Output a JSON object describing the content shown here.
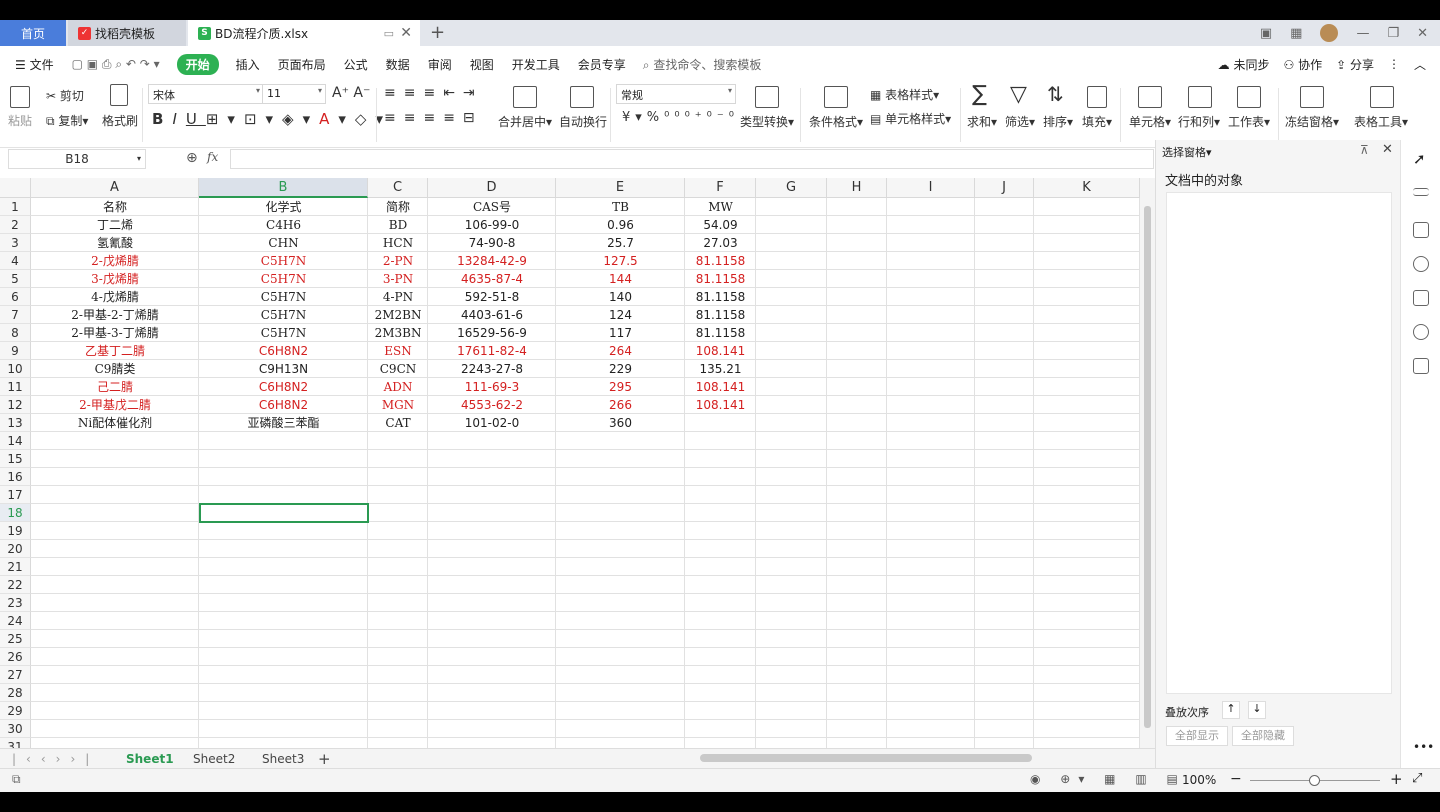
{
  "tabs": {
    "home": "首页",
    "docer": "找稻壳模板",
    "file": "BD流程介质.xlsx"
  },
  "menu": {
    "file": "文件",
    "items": [
      "开始",
      "插入",
      "页面布局",
      "公式",
      "数据",
      "审阅",
      "视图",
      "开发工具",
      "会员专享"
    ],
    "search": "查找命令、搜索模板",
    "sync": "未同步",
    "collab": "协作",
    "share": "分享"
  },
  "ribbon": {
    "paste": "粘贴",
    "cut": "剪切",
    "copy": "复制",
    "format_painter": "格式刷",
    "font": "宋体",
    "size": "11",
    "merge": "合并居中",
    "wrap": "自动换行",
    "number_format": "常规",
    "type_convert": "类型转换",
    "cond_format": "条件格式",
    "table_style": "表格样式",
    "cell_style": "单元格样式",
    "sum": "求和",
    "filter": "筛选",
    "sort": "排序",
    "fill": "填充",
    "cell": "单元格",
    "rowcol": "行和列",
    "sheet": "工作表",
    "freeze": "冻结窗格",
    "tools": "表格工具"
  },
  "formula_bar": {
    "cell_ref": "B18",
    "fx": "fx",
    "content": ""
  },
  "columns": [
    "A",
    "B",
    "C",
    "D",
    "E",
    "F",
    "G",
    "H",
    "I",
    "J",
    "K"
  ],
  "selected_col": "B",
  "selected_row": 18,
  "rows": [
    {
      "n": 1,
      "red": false,
      "cells": [
        "名称",
        "化学式",
        "简称",
        "CAS号",
        "TB",
        "MW"
      ]
    },
    {
      "n": 2,
      "red": false,
      "cells": [
        "丁二烯",
        "C4H6",
        "BD",
        "106-99-0",
        "0.96",
        "54.09"
      ]
    },
    {
      "n": 3,
      "red": false,
      "cells": [
        "氢氰酸",
        "CHN",
        "HCN",
        "74-90-8",
        "25.7",
        "27.03"
      ]
    },
    {
      "n": 4,
      "red": true,
      "cells": [
        "2-戊烯腈",
        "C5H7N",
        "2-PN",
        "13284-42-9",
        "127.5",
        "81.1158"
      ]
    },
    {
      "n": 5,
      "red": true,
      "cells": [
        "3-戊烯腈",
        "C5H7N",
        "3-PN",
        "4635-87-4",
        "144",
        "81.1158"
      ]
    },
    {
      "n": 6,
      "red": false,
      "cells": [
        "4-戊烯腈",
        "C5H7N",
        "4-PN",
        "592-51-8",
        "140",
        "81.1158"
      ]
    },
    {
      "n": 7,
      "red": false,
      "cells": [
        "2-甲基-2-丁烯腈",
        "C5H7N",
        "2M2BN",
        "4403-61-6",
        "124",
        "81.1158"
      ]
    },
    {
      "n": 8,
      "red": false,
      "cells": [
        "2-甲基-3-丁烯腈",
        "C5H7N",
        "2M3BN",
        "16529-56-9",
        "117",
        "81.1158"
      ]
    },
    {
      "n": 9,
      "red": true,
      "cells": [
        "乙基丁二腈",
        "C6H8N2",
        "ESN",
        "17611-82-4",
        "264",
        "108.141"
      ]
    },
    {
      "n": 10,
      "red": false,
      "cells": [
        "C9腈类",
        "C9H13N",
        "C9CN",
        "2243-27-8",
        "229",
        "135.21"
      ]
    },
    {
      "n": 11,
      "red": true,
      "cells": [
        "己二腈",
        "C6H8N2",
        "ADN",
        "111-69-3",
        "295",
        "108.141"
      ]
    },
    {
      "n": 12,
      "red": true,
      "cells": [
        "2-甲基戊二腈",
        "C6H8N2",
        "MGN",
        "4553-62-2",
        "266",
        "108.141"
      ]
    },
    {
      "n": 13,
      "red": false,
      "cells": [
        "Ni配体催化剂",
        "亚磷酸三苯酯",
        "CAT",
        "101-02-0",
        "360",
        ""
      ]
    },
    {
      "n": 14,
      "cells": []
    },
    {
      "n": 15,
      "cells": []
    },
    {
      "n": 16,
      "cells": []
    },
    {
      "n": 17,
      "cells": []
    },
    {
      "n": 18,
      "cells": []
    },
    {
      "n": 19,
      "cells": []
    },
    {
      "n": 20,
      "cells": []
    },
    {
      "n": 21,
      "cells": []
    },
    {
      "n": 22,
      "cells": []
    },
    {
      "n": 23,
      "cells": []
    },
    {
      "n": 24,
      "cells": []
    },
    {
      "n": 25,
      "cells": []
    },
    {
      "n": 26,
      "cells": []
    },
    {
      "n": 27,
      "cells": []
    },
    {
      "n": 28,
      "cells": []
    },
    {
      "n": 29,
      "cells": []
    },
    {
      "n": 30,
      "cells": []
    },
    {
      "n": 31,
      "cells": []
    }
  ],
  "sheets": [
    "Sheet1",
    "Sheet2",
    "Sheet3"
  ],
  "active_sheet": "Sheet1",
  "panel": {
    "title": "选择窗格",
    "heading": "文档中的对象",
    "order": "叠放次序",
    "show_all": "全部显示",
    "hide_all": "全部隐藏"
  },
  "status": {
    "zoom": "100%"
  },
  "colors": {
    "accent": "#2a9a52",
    "red_text": "#d42020",
    "home_tab": "#4a7ddb"
  }
}
